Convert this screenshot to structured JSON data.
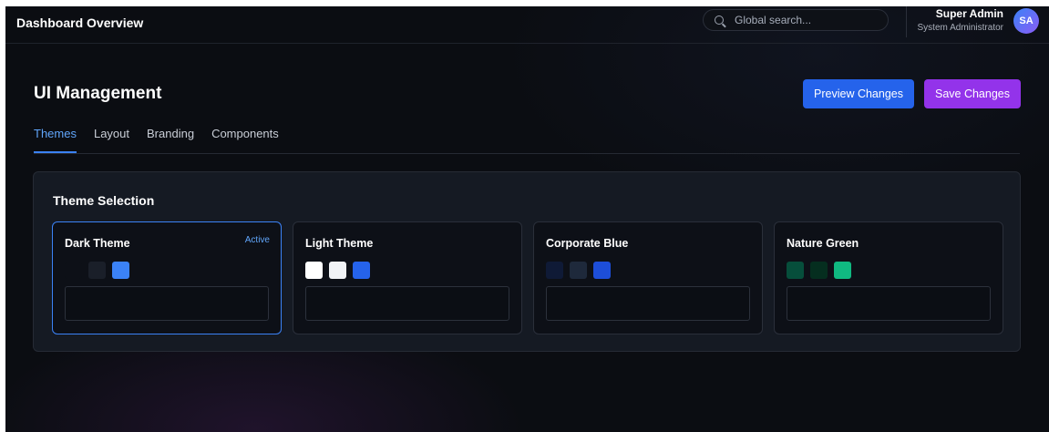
{
  "header": {
    "title": "Dashboard Overview",
    "search_placeholder": "Global search...",
    "user_name": "Super Admin",
    "user_role": "System Administrator",
    "avatar_initials": "SA"
  },
  "page": {
    "title": "UI Management",
    "preview_label": "Preview Changes",
    "save_label": "Save Changes"
  },
  "tabs": [
    {
      "label": "Themes",
      "active": true
    },
    {
      "label": "Layout",
      "active": false
    },
    {
      "label": "Branding",
      "active": false
    },
    {
      "label": "Components",
      "active": false
    }
  ],
  "themes_panel": {
    "title": "Theme Selection",
    "themes": [
      {
        "name": "Dark Theme",
        "badge": "Active",
        "colors": [
          "#0d1017",
          "#1a1f29",
          "#3b82f6"
        ]
      },
      {
        "name": "Light Theme",
        "badge": "",
        "colors": [
          "#ffffff",
          "#f1f3f6",
          "#2563eb"
        ]
      },
      {
        "name": "Corporate Blue",
        "badge": "",
        "colors": [
          "#0f1a36",
          "#1e293b",
          "#1d4ed8"
        ]
      },
      {
        "name": "Nature Green",
        "badge": "",
        "colors": [
          "#064e3b",
          "#052e1f",
          "#10b981"
        ]
      }
    ]
  },
  "colors": {
    "accent": "#3b82f6",
    "preview_button": "#2563eb",
    "save_button": "#9333ea"
  }
}
